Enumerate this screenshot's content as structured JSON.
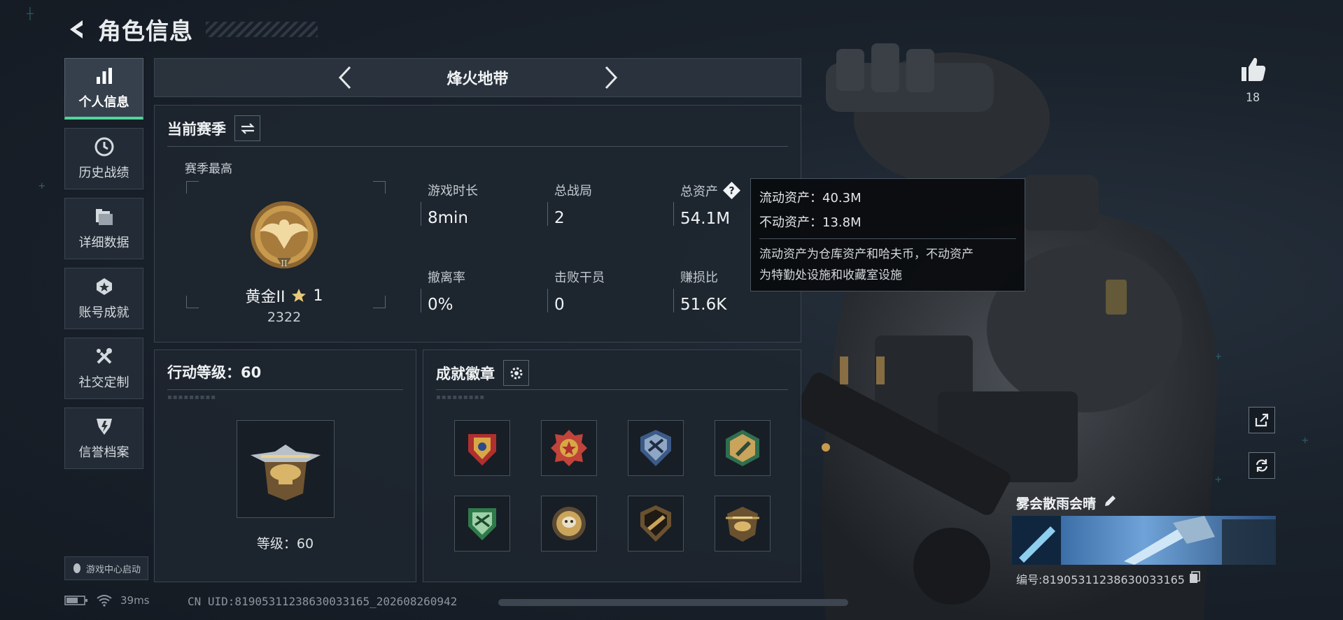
{
  "header": {
    "title": "角色信息"
  },
  "sidebar": {
    "items": [
      {
        "label": "个人信息",
        "icon": "bar-chart-icon",
        "active": true
      },
      {
        "label": "历史战绩",
        "icon": "clock-icon"
      },
      {
        "label": "详细数据",
        "icon": "folder-icon"
      },
      {
        "label": "账号成就",
        "icon": "star-badge-icon"
      },
      {
        "label": "社交定制",
        "icon": "tools-icon"
      },
      {
        "label": "信誉档案",
        "icon": "shield-icon"
      }
    ],
    "launch_label": "游戏中心启动"
  },
  "mode": {
    "title": "烽火地带"
  },
  "season": {
    "title": "当前赛季",
    "best_label": "赛季最高",
    "rank_name": "黄金II",
    "rank_stars": "1",
    "rank_score": "2322",
    "stats": [
      {
        "label": "游戏时长",
        "value": "8min"
      },
      {
        "label": "总战局",
        "value": "2"
      },
      {
        "label": "总资产",
        "value": "54.1M"
      },
      {
        "label": "撤离率",
        "value": "0%"
      },
      {
        "label": "击败干员",
        "value": "0"
      },
      {
        "label": "赚损比",
        "value": "51.6K"
      }
    ]
  },
  "tooltip": {
    "line1": "流动资产：40.3M",
    "line2": "不动资产：13.8M",
    "desc1": "流动资产为仓库资产和哈夫币，不动资产",
    "desc2": "为特勤处设施和收藏室设施"
  },
  "level": {
    "title": "行动等级：60",
    "label": "等级：60"
  },
  "badges": {
    "title": "成就徽章",
    "items": [
      "badge-icon-1",
      "badge-icon-2",
      "badge-icon-3",
      "badge-icon-4",
      "badge-icon-5",
      "badge-icon-6",
      "badge-icon-7",
      "badge-icon-8"
    ]
  },
  "profile": {
    "likes": "18",
    "nickname": "雾会散雨会晴",
    "id_text": "编号:81905311238630033165"
  },
  "status": {
    "ping": "39ms",
    "uid": "CN UID:81905311238630033165_202608260942"
  },
  "colors": {
    "accent": "#4fd69a",
    "gold": "#c89a4e",
    "panel": "#1e262f"
  }
}
